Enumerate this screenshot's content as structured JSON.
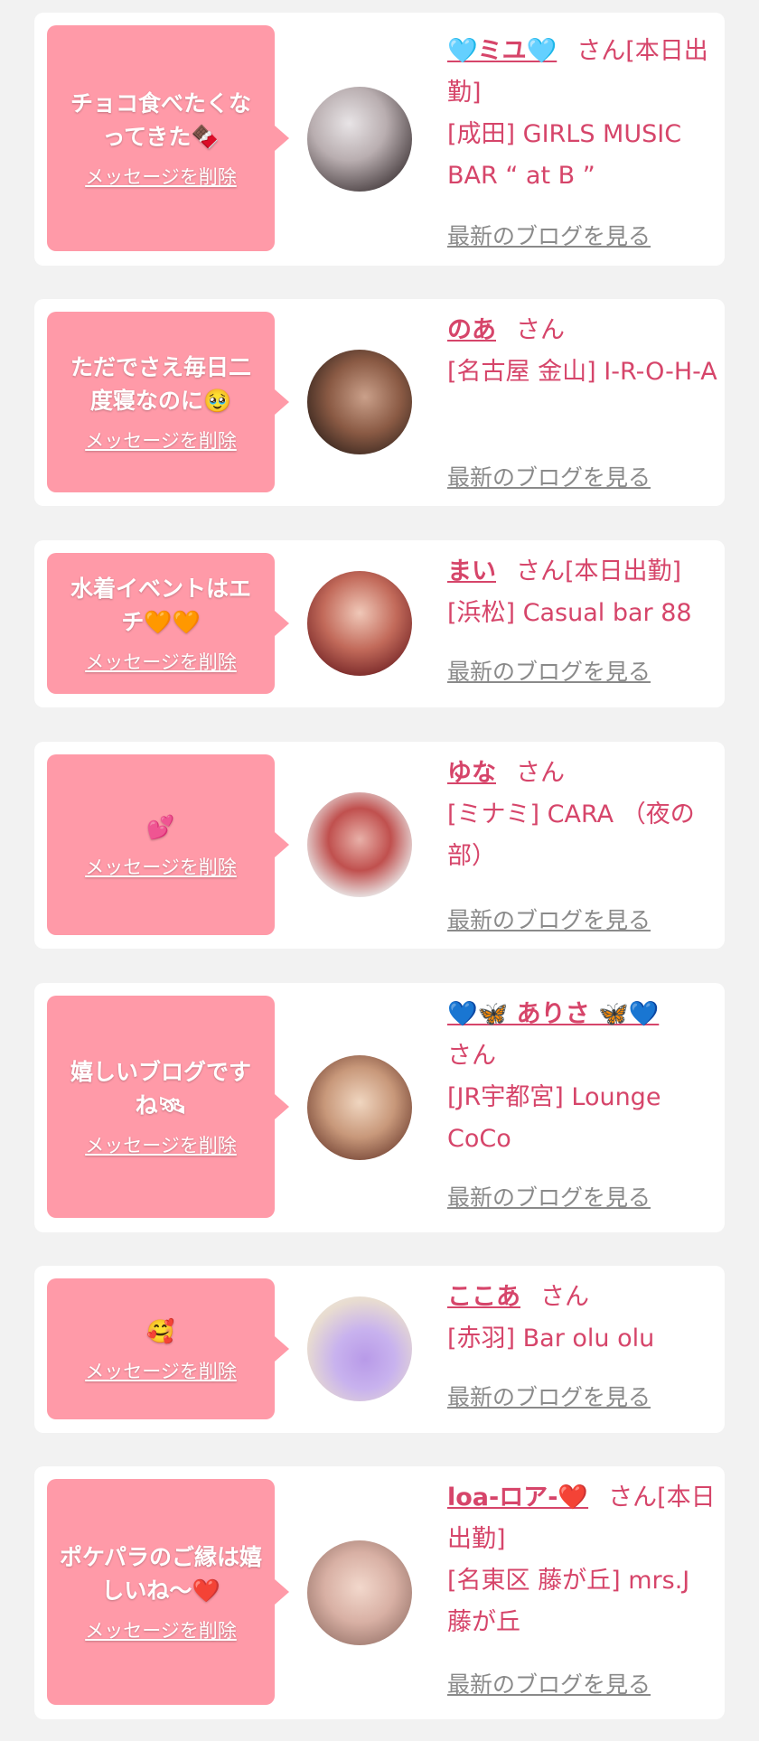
{
  "items": [
    {
      "message": "チョコ食べたくなってきた",
      "message_emoji": "🍫",
      "delete_label": "メッセージを削除",
      "name": "🩵ミユ🩵",
      "honorific": "さん",
      "status": "[本日出勤]",
      "shop": "[成田] GIRLS MUSIC BAR “ at B ”",
      "blog_label": "最新のブログを見る"
    },
    {
      "message": "ただでさえ毎日二度寝なのに",
      "message_emoji": "🥹",
      "delete_label": "メッセージを削除",
      "name": "のあ",
      "honorific": "さん",
      "status": "",
      "shop": "[名古屋 金山] I-R-O-H-A",
      "blog_label": "最新のブログを見る"
    },
    {
      "message": "水着イベントはエチ",
      "message_emoji": "🧡🧡",
      "delete_label": "メッセージを削除",
      "name": "まい",
      "honorific": "さん",
      "status": "[本日出勤]",
      "shop": "[浜松] Casual bar 88",
      "blog_label": "最新のブログを見る"
    },
    {
      "message": "",
      "message_emoji": "💕",
      "delete_label": "メッセージを削除",
      "name": "ゆな",
      "honorific": "さん",
      "status": "",
      "shop": "[ミナミ] CARA （夜の部）",
      "blog_label": "最新のブログを見る"
    },
    {
      "message": "嬉しいブログですね",
      "message_emoji": "🛰",
      "delete_label": "メッセージを削除",
      "name": "💙🦋 ありさ 🦋💙",
      "honorific": "さん",
      "status": "",
      "shop": "[JR宇都宮] Lounge CoCo",
      "blog_label": "最新のブログを見る"
    },
    {
      "message": "",
      "message_emoji": "🥰",
      "delete_label": "メッセージを削除",
      "name": "ここあ",
      "honorific": "さん",
      "status": "",
      "shop": "[赤羽] Bar olu olu",
      "blog_label": "最新のブログを見る"
    },
    {
      "message": "ポケパラのご縁は嬉しいね〜",
      "message_emoji": "❤️",
      "delete_label": "メッセージを削除",
      "name": "loa-ロア-❤️",
      "honorific": "さん",
      "status": "[本日出勤]",
      "shop": "[名東区 藤が丘] mrs.J 藤が丘",
      "blog_label": "最新のブログを見る"
    }
  ],
  "colors": {
    "bubble": "#ff9aa8",
    "name": "#d6456a",
    "blog_link": "#8a8a8a",
    "background": "#f2f2f2"
  }
}
